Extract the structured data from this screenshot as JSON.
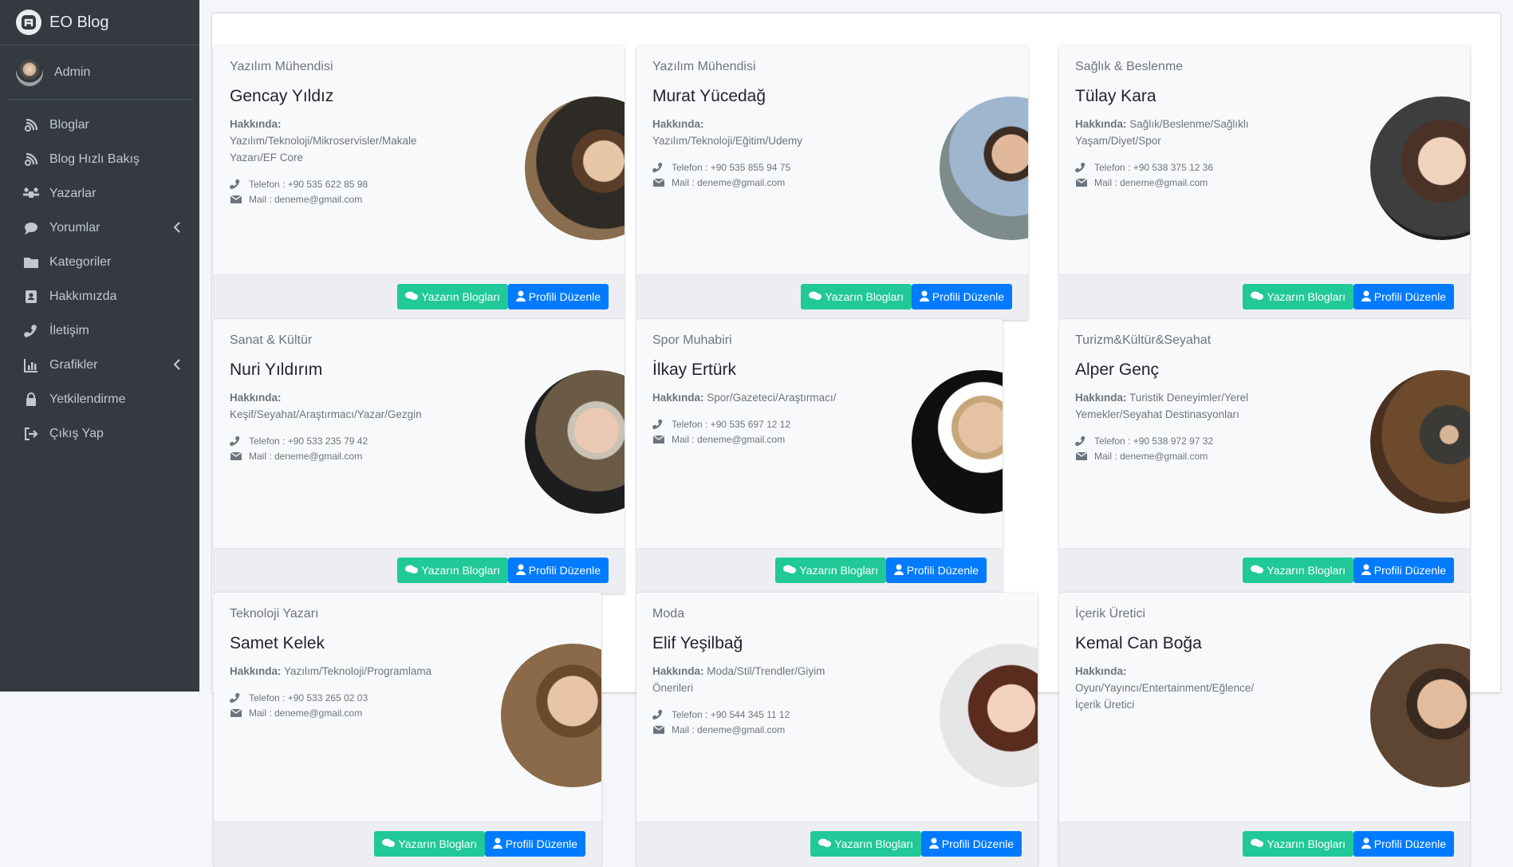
{
  "app": {
    "brand": "EO Blog",
    "user": "Admin"
  },
  "sidebar": {
    "items": [
      {
        "label": "Bloglar",
        "icon": "blog-icon",
        "has_caret": false
      },
      {
        "label": "Blog Hızlı Bakış",
        "icon": "blog-icon",
        "has_caret": false
      },
      {
        "label": "Yazarlar",
        "icon": "users-icon",
        "has_caret": false
      },
      {
        "label": "Yorumlar",
        "icon": "comment-icon",
        "has_caret": true
      },
      {
        "label": "Kategoriler",
        "icon": "folder-icon",
        "has_caret": false
      },
      {
        "label": "Hakkımızda",
        "icon": "address-book-icon",
        "has_caret": false
      },
      {
        "label": "İletişim",
        "icon": "phone-icon",
        "has_caret": false
      },
      {
        "label": "Grafikler",
        "icon": "chart-icon",
        "has_caret": true
      },
      {
        "label": "Yetkilendirme",
        "icon": "user-lock-icon",
        "has_caret": false
      },
      {
        "label": "Çıkış Yap",
        "icon": "sign-out-icon",
        "has_caret": false
      }
    ]
  },
  "labels": {
    "about_prefix": "Hakkında:",
    "btn_blogs": "Yazarın Blogları",
    "btn_edit": "Profili Düzenle"
  },
  "authors": [
    {
      "title": "Yazılım Mühendisi",
      "name": "Gencay Yıldız",
      "about": "Yazılım/Teknoloji/Mikroservisler/Makale Yazarı/EF Core",
      "phone": "Telefon : +90 535 622 85 98",
      "mail": "Mail : deneme@gmail.com"
    },
    {
      "title": "Yazılım Mühendisi",
      "name": "Murat Yücedağ",
      "about": "Yazılım/Teknoloji/Eğitim/Udemy",
      "phone": "Telefon : +90 535 855 94 75",
      "mail": "Mail : deneme@gmail.com"
    },
    {
      "title": "Sağlık & Beslenme",
      "name": "Tülay Kara",
      "about": "Sağlık/Beslenme/Sağlıklı Yaşam/Diyet/Spor",
      "phone": "Telefon : +90 538 375 12 36",
      "mail": "Mail : deneme@gmail.com"
    },
    {
      "title": "Sanat & Kültür",
      "name": "Nuri Yıldırım",
      "about": "Keşif/Seyahat/Araştırmacı/Yazar/Gezgin",
      "phone": "Telefon : +90 533 235 79 42",
      "mail": "Mail : deneme@gmail.com"
    },
    {
      "title": "Spor Muhabiri",
      "name": "İlkay Ertürk",
      "about": "Spor/Gazeteci/Araştırmacı/",
      "phone": "Telefon : +90 535 697 12 12",
      "mail": "Mail : deneme@gmail.com"
    },
    {
      "title": "Turizm&Kültür&Seyahat",
      "name": "Alper Genç",
      "about": "Turistik Deneyimler/Yerel Yemekler/Seyahat Destinasyonları",
      "phone": "Telefon : +90 538 972 97 32",
      "mail": "Mail : deneme@gmail.com"
    },
    {
      "title": "Teknoloji Yazarı",
      "name": "Samet Kelek",
      "about": "Yazılım/Teknoloji/Programlama",
      "phone": "Telefon : +90 533 265 02 03",
      "mail": "Mail : deneme@gmail.com"
    },
    {
      "title": "Moda",
      "name": "Elif Yeşilbağ",
      "about": "Moda/Stil/Trendler/Giyim Önerileri",
      "phone": "Telefon : +90 544 345 11 12",
      "mail": "Mail : deneme@gmail.com"
    },
    {
      "title": "İçerik Üretici",
      "name": "Kemal Can Boğa",
      "about": "Oyun/Yayıncı/Entertainment/Eğlence/İçerik Üretici",
      "phone": "",
      "mail": ""
    }
  ]
}
